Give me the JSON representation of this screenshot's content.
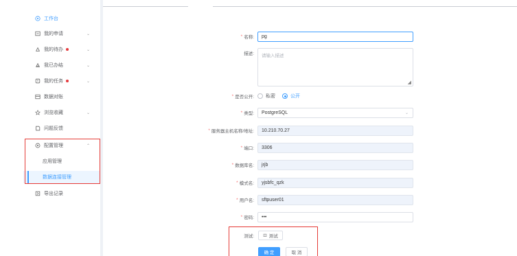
{
  "sidebar": {
    "items": [
      {
        "label": "工作台",
        "icon": "dashboard-icon",
        "active": true
      },
      {
        "label": "我的申请",
        "icon": "apply-icon",
        "chevron": "⌄"
      },
      {
        "label": "我的待办",
        "icon": "todo-icon",
        "chevron": "⌄",
        "badge": true
      },
      {
        "label": "我已办结",
        "icon": "done-icon",
        "chevron": "⌄"
      },
      {
        "label": "我的任务",
        "icon": "task-icon",
        "chevron": "⌄",
        "badge": true
      },
      {
        "label": "数据对账",
        "icon": "reconcile-icon"
      },
      {
        "label": "浏览收藏",
        "icon": "star-icon",
        "chevron": "⌄"
      },
      {
        "label": "问题反馈",
        "icon": "feedback-icon"
      },
      {
        "label": "配置管理",
        "icon": "config-icon",
        "chevron": "⌃"
      },
      {
        "label": "导出记录",
        "icon": "export-icon"
      }
    ],
    "sub_items": [
      {
        "label": "应用管理"
      },
      {
        "label": "数据连接管理",
        "active": true
      }
    ]
  },
  "form": {
    "name": {
      "label": "名称:",
      "value": "pg"
    },
    "desc": {
      "label": "描述:",
      "placeholder": "请输入描述"
    },
    "public": {
      "label": "是否公开:",
      "options": [
        "私密",
        "公开"
      ],
      "selected": "公开"
    },
    "type": {
      "label": "类型:",
      "value": "PostgreSQL"
    },
    "host": {
      "label": "服务器主机名称/地址:",
      "value": "10.210.70.27"
    },
    "port": {
      "label": "端口:",
      "value": "3306"
    },
    "dbname": {
      "label": "数据库名:",
      "value": "jrjb"
    },
    "schema": {
      "label": "模式名:",
      "value": "yjsbfc_qzk"
    },
    "user": {
      "label": "用户名:",
      "value": "sftpuser01"
    },
    "password": {
      "label": "密码:",
      "value": "•••"
    },
    "test": {
      "label": "测试:",
      "button": "测试"
    },
    "confirm": "确 定",
    "cancel": "取 消"
  },
  "colors": {
    "accent": "#409eff",
    "required": "#f56c6c",
    "highlight_box": "#e53935",
    "badge": "#e4393c"
  }
}
